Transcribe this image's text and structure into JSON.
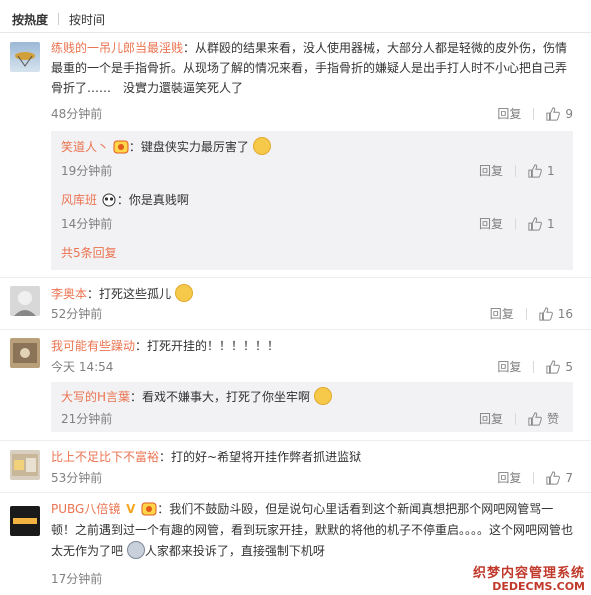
{
  "tabs": {
    "hot": "按热度",
    "time": "按时间"
  },
  "c1": {
    "user": "练贱的一吊儿郎当最淫贱",
    "text": "：从群殴的结果来看，没人使用器械，大部分人都是轻微的皮外伤，伤情最重的一个是手指骨折。从现场了解的情况来看，手指骨折的嫌疑人是出手打人时不小心把自己弄骨折了……　没實力還裝逼笑死人了",
    "time": "48分钟前",
    "reply": "回复",
    "likes": "9",
    "subs": [
      {
        "user": "笑道人丶",
        "text": "：键盘侠实力最厉害了",
        "time": "19分钟前",
        "reply": "回复",
        "likes": "1"
      },
      {
        "user": "风库班",
        "text": "：你是真贱啊",
        "time": "14分钟前",
        "reply": "回复",
        "likes": "1"
      }
    ],
    "more": "共5条回复"
  },
  "c2": {
    "user": "李奥本",
    "text": "：打死这些孤儿",
    "time": "52分钟前",
    "reply": "回复",
    "likes": "16"
  },
  "c3": {
    "user": "我可能有些躁动",
    "text": "：打死开挂的！！！！！！",
    "time": "今天 14:54",
    "reply": "回复",
    "likes": "5",
    "subs": [
      {
        "user": "大写的H言葉",
        "text": "：看戏不嫌事大，打死了你坐牢啊",
        "time": "21分钟前",
        "reply": "回复",
        "likes": "赞"
      }
    ]
  },
  "c4": {
    "user": "比上不足比下不富裕",
    "text": "：打的好~希望将开挂作弊者抓进监狱",
    "time": "53分钟前",
    "reply": "回复",
    "likes": "7"
  },
  "c5": {
    "user": "PUBG八倍镜",
    "vmark": "V",
    "text1": "：我们不鼓励斗殴，但是说句心里话看到这个新闻真想把那个网吧网管骂一顿！之前遇到过一个有趣的网管，看到玩家开挂，默默的将他的机子不停重启。。。。这个网吧网管也太无作为了吧",
    "text2": "人家都来投诉了，直接强制下机呀",
    "time": "17分钟前"
  },
  "watermark": {
    "line1": "织梦内容管理系统",
    "line2": "DEDECMS.COM"
  },
  "colors": {
    "accent": "#eb7350",
    "subbg": "#f2f2f5"
  }
}
